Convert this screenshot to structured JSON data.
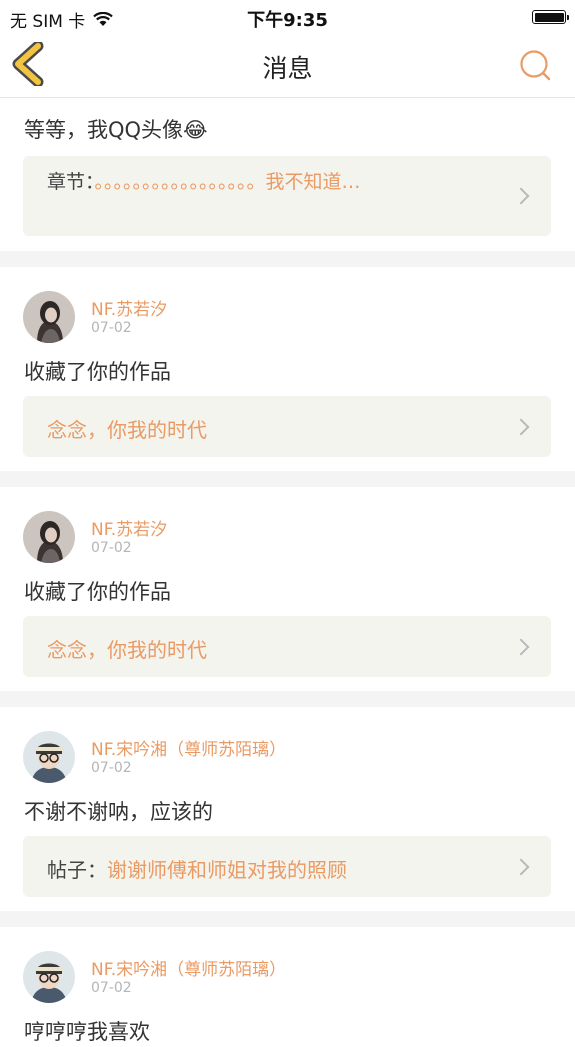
{
  "status_bar": {
    "carrier": "无 SIM 卡",
    "time": "下午9:35"
  },
  "nav": {
    "title": "消息"
  },
  "top_partial": {
    "text": "等等，我QQ头像😂",
    "ref_prefix": "章节：",
    "ref_title": "。。。。。。。。。。。。。。。。。我不知道…"
  },
  "messages": [
    {
      "username": "NF.苏若汐",
      "date": "07-02",
      "text": "收藏了你的作品",
      "ref_prefix": "",
      "ref_title": "念念，你我的时代"
    },
    {
      "username": "NF.苏若汐",
      "date": "07-02",
      "text": "收藏了你的作品",
      "ref_prefix": "",
      "ref_title": "念念，你我的时代"
    },
    {
      "username": "NF.宋吟湘（尊师苏陌璃）",
      "date": "07-02",
      "text": "不谢不谢呐，应该的",
      "ref_prefix": "帖子：",
      "ref_title": "谢谢师傅和师姐对我的照顾"
    },
    {
      "username": "NF.宋吟湘（尊师苏陌璃）",
      "date": "07-02",
      "text": "哼哼哼我喜欢"
    }
  ],
  "colors": {
    "accent": "#EA9A63",
    "back_icon_fill": "#F2C441",
    "ref_bg": "#F4F4EE",
    "separator": "#F4F4F4"
  },
  "icons": {
    "back": "chevron-left-icon",
    "search": "search-icon",
    "wifi": "wifi-icon",
    "battery": "battery-icon",
    "chevron": "chevron-right-icon"
  }
}
